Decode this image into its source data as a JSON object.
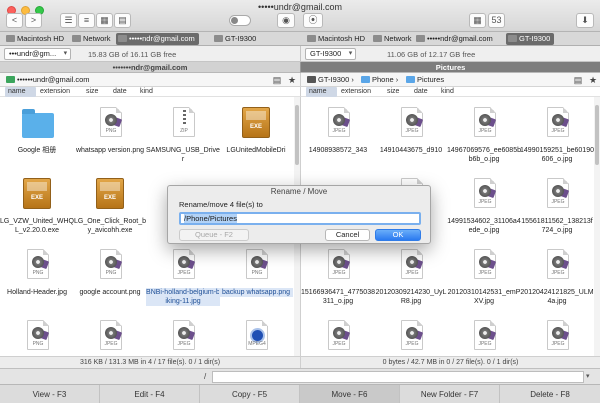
{
  "window": {
    "title": "•••••undr@gmail.com"
  },
  "toolbar": {
    "back": "<",
    "forward": ">",
    "view1": "☰",
    "view2": "≡",
    "view3": "▦",
    "view4": "▤",
    "eye": "◉",
    "binoculars": "⦿",
    "size_label": "53",
    "download": "⬇"
  },
  "drives_left": [
    {
      "name": "Macintosh HD",
      "active": false
    },
    {
      "name": "Network",
      "active": false
    },
    {
      "name": "•••••ndr@gmail.com",
      "active": true
    },
    {
      "name": "GT-I9300",
      "active": false
    }
  ],
  "drives_right": [
    {
      "name": "Macintosh HD",
      "active": false
    },
    {
      "name": "Network",
      "active": false
    },
    {
      "name": "•••••ndr@gmail.com",
      "active": false
    },
    {
      "name": "GT-I9300",
      "active": true
    }
  ],
  "left_panel": {
    "drive_select": "•••undr@gm...",
    "free": "15.83 GB of 16.11 GB free",
    "header": "•••••••ndr@gmail.com",
    "path": [
      "••••••undr@gmail.com"
    ],
    "status": "316 KB / 131.3 MB in 4 / 17 file(s). 0 / 1 dir(s)"
  },
  "right_panel": {
    "drive_select": "GT-I9300",
    "free": "11.06 GB of 12.17 GB free",
    "header": "Pictures",
    "path": [
      "GT-I9300",
      "Phone",
      "Pictures"
    ],
    "status": "0 bytes / 42.7 MB in 0 / 27 file(s). 0 / 1 dir(s)"
  },
  "columns": {
    "name": "name",
    "extension": "extension",
    "size": "size",
    "date": "date",
    "kind": "kind"
  },
  "left_files": [
    {
      "name": "Google 相册",
      "type": "folder",
      "selected": false
    },
    {
      "name": "whatsapp version.png",
      "type": "png",
      "selected": false
    },
    {
      "name": "SAMSUNG_USB_Driver",
      "type": "zip",
      "selected": false
    },
    {
      "name": "LGUnitedMobileDri",
      "type": "exe",
      "selected": false
    },
    {
      "name": "LG_VZW_United_WHQL_v2.20.0.exe",
      "type": "exe",
      "selected": false
    },
    {
      "name": "LG_One_Click_Root_by_avicohh.exe",
      "type": "exe",
      "selected": false
    },
    {
      "name": "",
      "type": "hidden",
      "selected": false
    },
    {
      "name": "",
      "type": "hidden",
      "selected": false
    },
    {
      "name": "Holland-Header.jpg",
      "type": "png",
      "selected": false
    },
    {
      "name": "google account.png",
      "type": "png",
      "selected": false
    },
    {
      "name": "BNBi-holland-belgium-biking-11.jpg",
      "type": "jpeg",
      "selected": true
    },
    {
      "name": "backup whatsapp.png",
      "type": "png",
      "selected": true
    },
    {
      "name": "",
      "type": "png",
      "selected": false
    },
    {
      "name": "",
      "type": "jpeg",
      "selected": false
    },
    {
      "name": "",
      "type": "jpeg",
      "selected": false
    },
    {
      "name": "",
      "type": "mpeg4",
      "selected": false
    }
  ],
  "right_files": [
    {
      "name": "14908938572_343",
      "type": "jpeg"
    },
    {
      "name": "14910443675_d910",
      "type": "jpeg"
    },
    {
      "name": "14967069576_ee6085bb6b_o.jpg",
      "type": "jpeg"
    },
    {
      "name": "14990159251_be60190606_o.jpg",
      "type": "jpeg"
    },
    {
      "name": "",
      "type": "hidden"
    },
    {
      "name": "...caa",
      "type": "jpeg"
    },
    {
      "name": "14991534602_31106a4ede_o.jpg",
      "type": "jpeg"
    },
    {
      "name": "15561811562_138213f724_o.jpg",
      "type": "jpeg"
    },
    {
      "name": "15166936471_4775038311_o.jpg",
      "type": "jpeg"
    },
    {
      "name": "20120309214230_UyLR8.jpg",
      "type": "jpeg"
    },
    {
      "name": "20120310142531_emPXV.jpg",
      "type": "jpeg"
    },
    {
      "name": "20120424121825_ULM4a.jpg",
      "type": "jpeg"
    },
    {
      "name": "",
      "type": "jpeg"
    },
    {
      "name": "",
      "type": "jpeg"
    },
    {
      "name": "",
      "type": "jpeg"
    },
    {
      "name": "",
      "type": "jpeg"
    }
  ],
  "file_type_labels": {
    "png": "PNG",
    "jpeg": "JPEG",
    "zip": "ZIP",
    "exe": "EXE",
    "mpeg4": "MPEG4"
  },
  "commandline": {
    "prompt": "/",
    "value": ""
  },
  "function_keys": [
    {
      "label": "View - F3",
      "pressed": false
    },
    {
      "label": "Edit - F4",
      "pressed": false
    },
    {
      "label": "Copy - F5",
      "pressed": false
    },
    {
      "label": "Move - F6",
      "pressed": true
    },
    {
      "label": "New Folder - F7",
      "pressed": false
    },
    {
      "label": "Delete - F8",
      "pressed": false
    }
  ],
  "dialog": {
    "title": "Rename / Move",
    "message": "Rename/move 4 file(s) to",
    "destination": "/Phone/Pictures",
    "queue_label": "Queue - F2",
    "cancel_label": "Cancel",
    "ok_label": "OK"
  },
  "colors": {
    "accent": "#2b7af0",
    "selection": "#dbe6f6",
    "folder": "#5ab0ea"
  }
}
